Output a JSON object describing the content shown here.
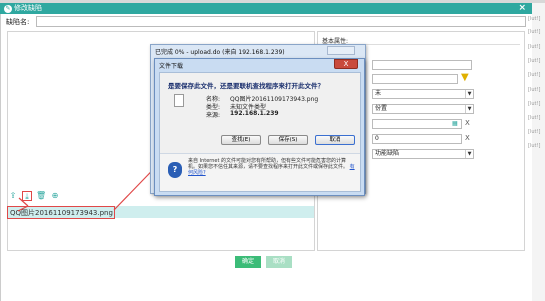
{
  "dialog": {
    "title": "修改缺陷",
    "close": "×"
  },
  "form": {
    "defect_name_label": "缺陷名:",
    "defect_name_value": ""
  },
  "right_panel": {
    "section_title": "基本属性:",
    "field_value_1": "",
    "field_value_2": "",
    "select_1": "未",
    "select_2": "份置",
    "input_3": "",
    "input_4": "0",
    "select_5": "功能缺陷",
    "clear_x": "X"
  },
  "side_labels": [
    "[lut!]",
    "[lut!]",
    "[lut!]",
    "[lut!]",
    "[lut!]",
    "[lut!]",
    "[lut!]",
    "[lut!]",
    "[lut!]",
    "[lut!]"
  ],
  "toolbar": {
    "icons": [
      "upload-icon",
      "download-icon",
      "delete-icon",
      "zoom-icon"
    ]
  },
  "attachments": [
    {
      "name": "QQ图片20161109173943.png"
    }
  ],
  "buttons": {
    "confirm": "确定",
    "cancel": "取消"
  },
  "ie_progress": {
    "title": "已完成 0% - upload.do (来自 192.168.1.239)"
  },
  "file_download": {
    "title": "文件下载",
    "close": "X",
    "question": "是要保存此文件，还是要联机查找程序来打开此文件？",
    "name_label": "名称:",
    "name_value": "QQ图片20161109173943.png",
    "type_label": "类型:",
    "type_value": "未知文件类型",
    "from_label": "来源:",
    "from_value": "192.168.1.239",
    "find_button": "查找(E)",
    "save_button": "保存(S)",
    "cancel_button": "取消",
    "warning_text": "来自 Internet 的文件可能对您有所帮助，但有些文件可能危害您的计算机。如果您不信任其来源，请不要查找程序来打开此文件或保存此文件。",
    "warning_link": "有何风险?"
  },
  "colors": {
    "title_bar": "#2fa8a0",
    "primary_button": "#3cbc78",
    "annotation": "#e04848"
  }
}
